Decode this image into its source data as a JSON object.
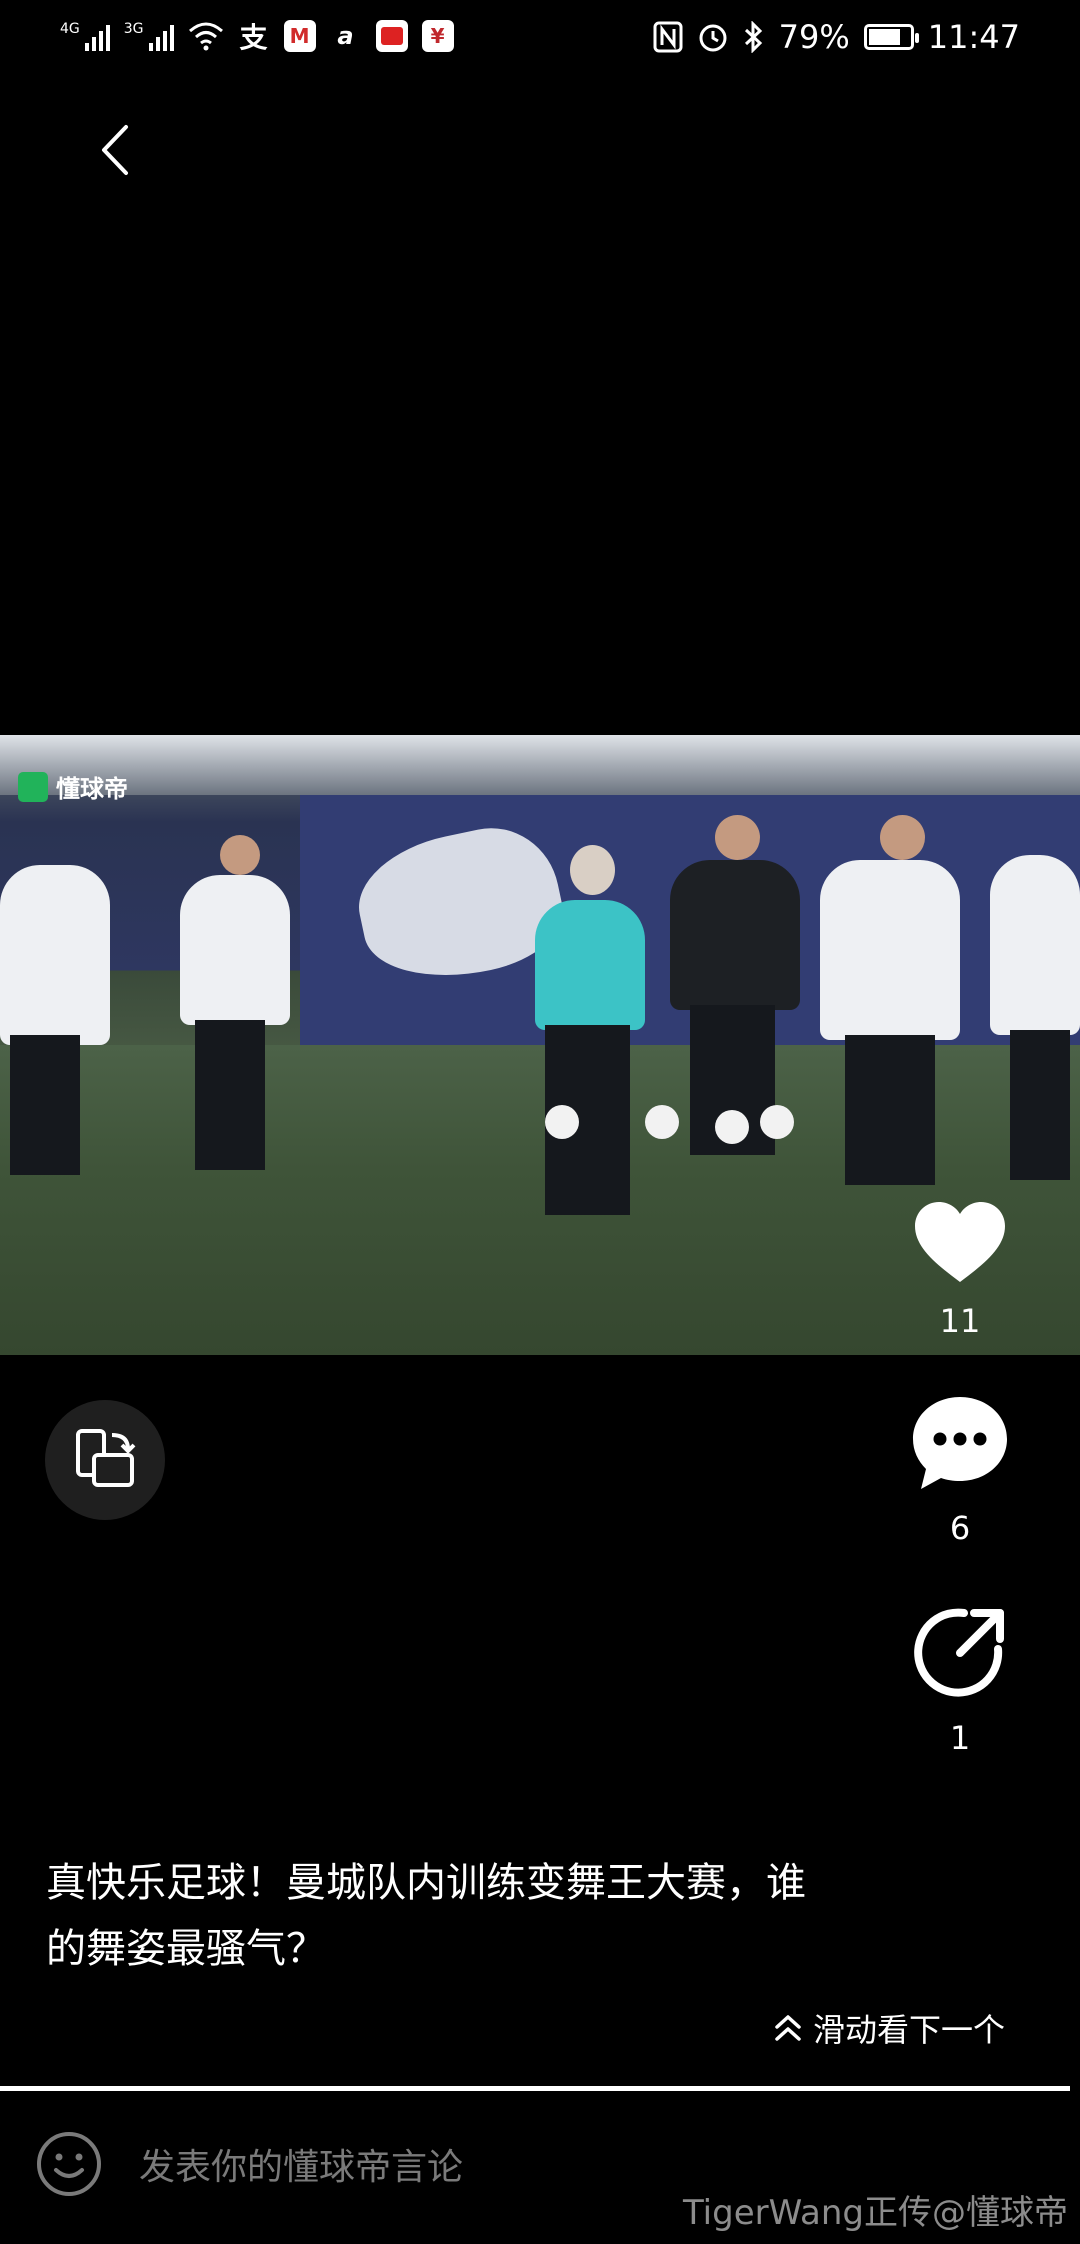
{
  "status_bar": {
    "net1": "4G",
    "net2": "3G",
    "battery": "79%",
    "battery_level": 0.79,
    "time": "11:47"
  },
  "video": {
    "logo_text": "懂球帝"
  },
  "actions": {
    "likes": "11",
    "comments": "6",
    "shares": "1"
  },
  "post": {
    "caption_line1": "真快乐足球！曼城队内训练变舞王大赛，谁",
    "caption_line2": "的舞姿最骚气？",
    "swipe_hint": "滑动看下一个"
  },
  "comment": {
    "placeholder": "发表你的懂球帝言论"
  },
  "watermark": "TigerWang正传@懂球帝",
  "icons": [
    "back-icon",
    "rotate-screen-icon",
    "heart-icon",
    "comment-icon",
    "share-icon",
    "chevron-up-icon",
    "emoji-icon"
  ],
  "colors": {
    "background": "#000000",
    "foreground": "#ffffff",
    "placeholder": "#7a7a7a",
    "watermark": "#8c8c8c"
  }
}
